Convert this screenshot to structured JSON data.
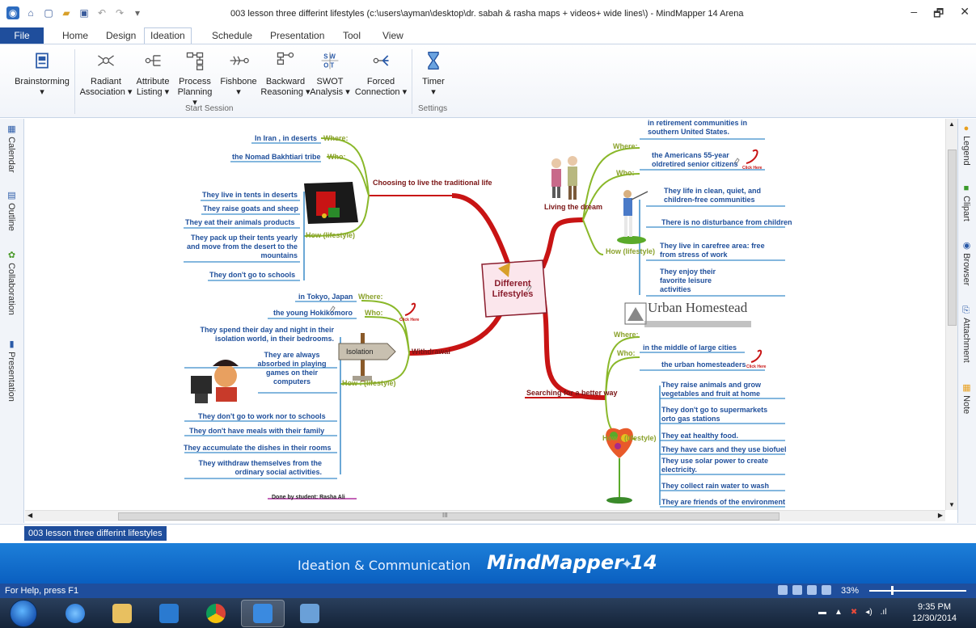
{
  "window": {
    "title": "003 lesson three differint lifestyles (c:\\users\\ayman\\desktop\\dr. sabah & rasha maps + videos+ wide lines\\) - MindMapper 14 Arena",
    "controls": [
      "–",
      "🗗",
      "✕"
    ]
  },
  "ribbon": {
    "tabs": [
      "File",
      "Home",
      "Design",
      "Ideation",
      "Schedule",
      "Presentation",
      "Tool",
      "View"
    ],
    "active_tab": "Ideation",
    "right_icons": "▾ 🔍 ▾  ❓ ▾  🗕  ✕",
    "buttons": [
      {
        "label": "Brainstorming",
        "sub": "▾"
      },
      {
        "label": "Radiant",
        "sub": "Association ▾"
      },
      {
        "label": "Attribute",
        "sub": "Listing ▾"
      },
      {
        "label": "Process",
        "sub": "Planning ▾"
      },
      {
        "label": "Fishbone",
        "sub": "▾"
      },
      {
        "label": "Backward",
        "sub": "Reasoning ▾"
      },
      {
        "label": "SWOT",
        "sub": "Analysis ▾"
      },
      {
        "label": "Forced",
        "sub": "Connection ▾"
      },
      {
        "label": "Timer",
        "sub": "▾"
      }
    ],
    "groups": [
      "Start Session",
      "Settings"
    ]
  },
  "left_panel": [
    "Calendar",
    "Outline",
    "Collaboration",
    "Presentation"
  ],
  "right_panel": [
    "Legend",
    "Clipart",
    "Browser",
    "Attachment",
    "Note"
  ],
  "map": {
    "center": "Different Lifestyles",
    "branches": {
      "traditional": "Choosing  to live the traditional life",
      "dream": "Living the dream",
      "withdrawal": "Withdrawal",
      "better": "Searching for a better way"
    },
    "labels": {
      "where": "Where:",
      "who": "Who:",
      "how": "How (lifestyle)",
      "how_spaced": "How : (lifestyle)",
      "how_dream": "How (lifestyle)",
      "how_better": "How : (lifestyle)"
    },
    "traditional": {
      "where": "In Iran , in deserts",
      "who": "the Nomad Bakhtiari tribe",
      "how": [
        "They live in tents in deserts",
        "They raise goats and sheep",
        "They eat their animals products",
        "They pack up their tents yearly and move from the desert to the mountains",
        "They don't go to schools"
      ]
    },
    "withdrawal": {
      "where": "in Tokyo, Japan",
      "who": "the young Hokikomoro",
      "isolation_sign": "Isolation",
      "how": [
        "They spend their day and night in their isolation world, in their bedrooms.",
        "They are always absorbed in playing games on their computers",
        "They don't go to work nor to schools",
        "They don't have meals with their family",
        "They accumulate the dishes in their rooms",
        "They withdraw themselves from the ordinary social activities."
      ],
      "footer": "Done  by  student:  Rasha  Ali"
    },
    "dream": {
      "where": "in retirement communities in southern United States.",
      "who": "the Americans 55-year oldretired senior citizens",
      "how": [
        "They life in clean, quiet, and children-free communities",
        "There is no disturbance from children",
        "They live in carefree area: free from stress of work",
        "They enjoy their favorite leisure activities"
      ]
    },
    "better": {
      "urban": "Urban Homestead",
      "where": "in the middle of large cities",
      "who": "the urban homesteaders",
      "how": [
        "They raise animals and grow vegetables and fruit at home",
        "They don't  go to supermarkets orto gas stations",
        "They eat healthy food.",
        "They have cars and they use biofuel",
        "They use solar power to create electricity.",
        "They collect  rain water to wash",
        "They are friends of the environment"
      ]
    },
    "click_here": "Click Here"
  },
  "scroll": {
    "h_mid": "III"
  },
  "doc_tab": "003 lesson three differint lifestyles",
  "banner": {
    "left": "Ideation & Communication",
    "right": "MindMapper 14"
  },
  "status": {
    "help": "For Help, press F1",
    "zoom": "33%"
  },
  "clock": {
    "time": "9:35 PM",
    "date": "12/30/2014"
  }
}
